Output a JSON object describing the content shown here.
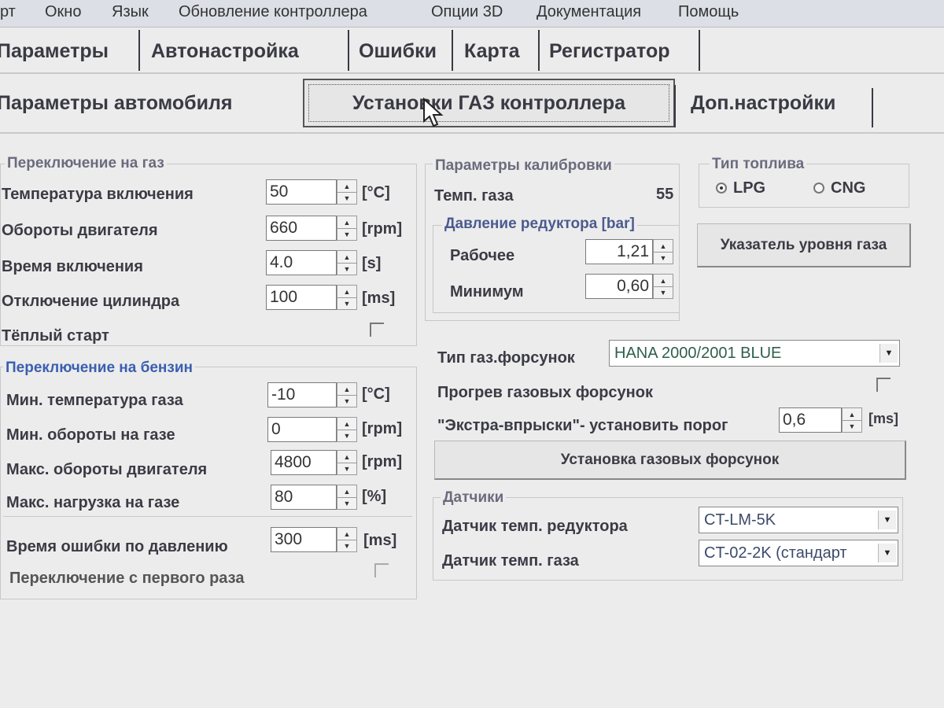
{
  "menu": [
    "рт",
    "Окно",
    "Язык",
    "Обновление контроллера",
    "Опции 3D",
    "Документация",
    "Помощь"
  ],
  "main_tabs": [
    "Параметры",
    "Автонастройка",
    "Ошибки",
    "Карта",
    "Регистратор"
  ],
  "sub_tabs": [
    "Параметры автомобиля",
    "Установки ГАЗ контроллера",
    "Доп.настройки"
  ],
  "switch_to_gas": {
    "title": "Переключение на газ",
    "rows": [
      {
        "label": "Температура включения",
        "value": "50",
        "unit": "[°C]"
      },
      {
        "label": "Обороты двигателя",
        "value": "660",
        "unit": "[rpm]"
      },
      {
        "label": "Время включения",
        "value": "4.0",
        "unit": "[s]"
      },
      {
        "label": "Отключение цилиндра",
        "value": "100",
        "unit": "[ms]"
      }
    ],
    "warm_start_label": "Тёплый старт"
  },
  "switch_to_petrol": {
    "title": "Переключение на бензин",
    "rows": [
      {
        "label": "Мин. температура газа",
        "value": "-10",
        "unit": "[°C]"
      },
      {
        "label": "Мин. обороты на газе",
        "value": "0",
        "unit": "[rpm]"
      },
      {
        "label": "Макс. обороты двигателя",
        "value": "4800",
        "unit": "[rpm]"
      },
      {
        "label": "Макс. нагрузка на газе",
        "value": "80",
        "unit": "[%]"
      }
    ],
    "pressure_error": {
      "label": "Время ошибки по давлению",
      "value": "300",
      "unit": "[ms]"
    },
    "first_time_label": "Переключение с первого раза"
  },
  "calibration": {
    "title": "Параметры калибровки",
    "gas_temp_label": "Темп. газа",
    "gas_temp_value": "55",
    "pressure": {
      "title": "Давление редуктора [bar]",
      "working_label": "Рабочее",
      "working_value": "1,21",
      "minimum_label": "Минимум",
      "minimum_value": "0,60"
    }
  },
  "fuel_type": {
    "title": "Тип топлива",
    "options": [
      "LPG",
      "CNG"
    ],
    "selected": "LPG"
  },
  "gas_level_button": "Указатель уровня газа",
  "injectors": {
    "type_label": "Тип газ.форсунок",
    "type_value": "HANA 2000/2001 BLUE",
    "warmup_label": "Прогрев газовых форсунок",
    "extra_label": "\"Экстра-впрыски\"- установить порог",
    "extra_value": "0,6",
    "extra_unit": "[ms]",
    "setup_button": "Установка газовых форсунок"
  },
  "sensors": {
    "title": "Датчики",
    "reducer_label": "Датчик темп. редуктора",
    "reducer_value": "CT-LM-5K",
    "gas_label": "Датчик темп. газа",
    "gas_value": "CT-02-2K (стандарт"
  },
  "colors": {
    "accent_blue": "#3a5fb0",
    "select_text": "#3c4a6b",
    "background": "#ececec"
  }
}
